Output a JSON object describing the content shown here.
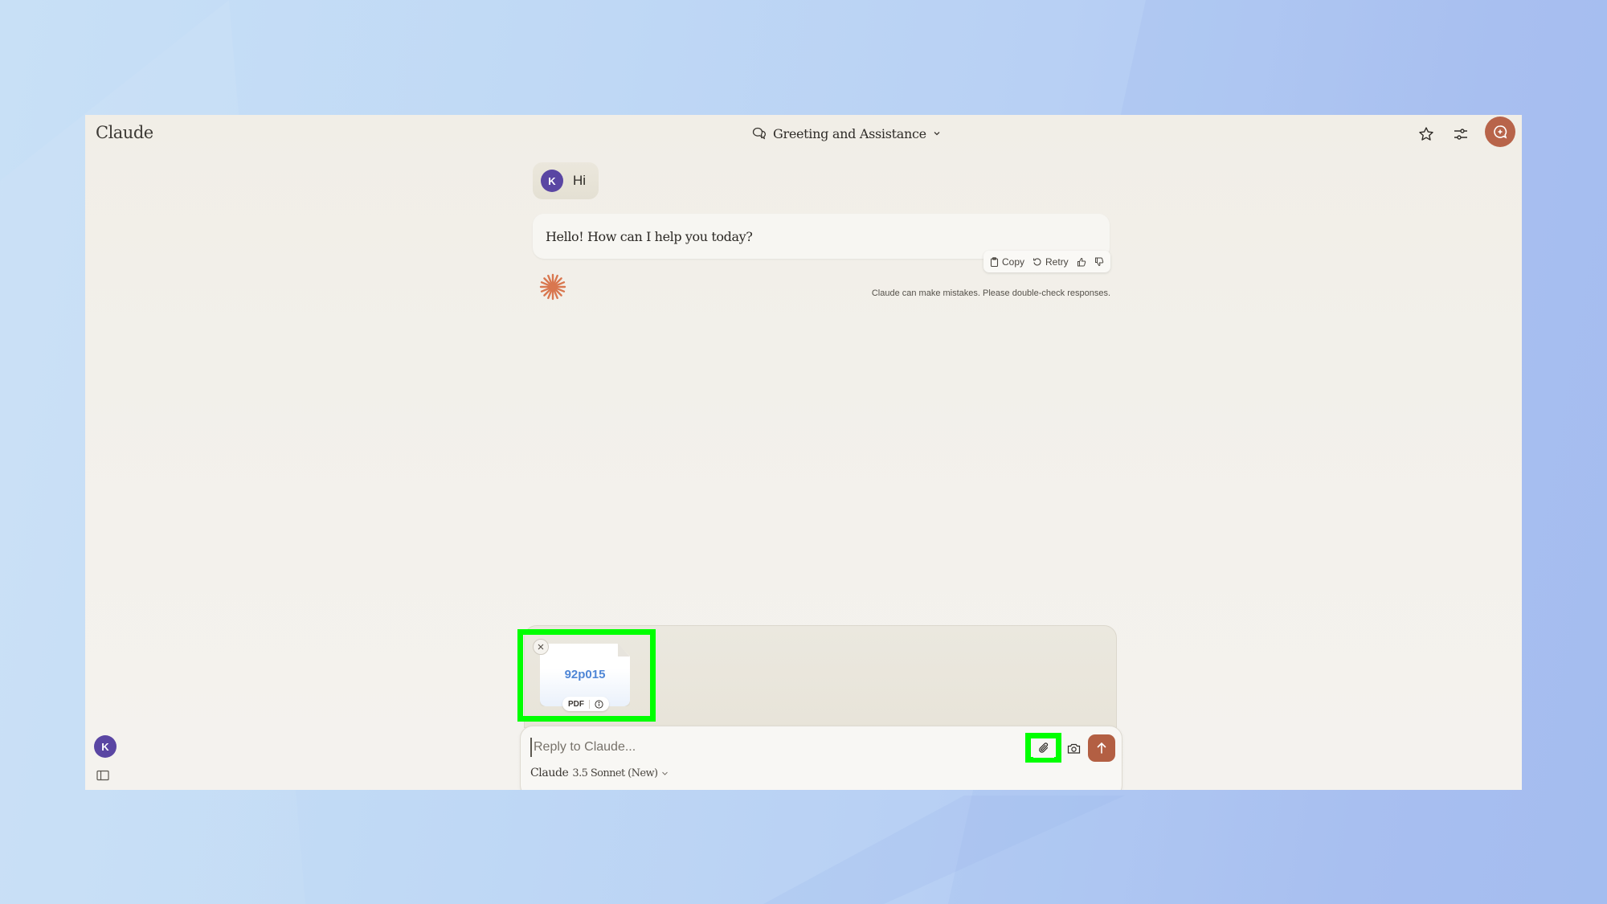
{
  "app": {
    "title": "Claude"
  },
  "header": {
    "conversation_title": "Greeting and Assistance",
    "icons": {
      "conversation": "chat-bubbles-icon",
      "dropdown": "chevron-down-icon",
      "star": "star-icon",
      "settings": "sliders-icon",
      "new_chat": "new-chat-icon"
    }
  },
  "colors": {
    "accent": "#b8644a",
    "send_button": "#b35f43",
    "avatar": "#5a46a3",
    "highlight": "#00ff00",
    "file_name": "#4f86d6"
  },
  "conversation": {
    "messages": [
      {
        "role": "user",
        "avatar_initial": "K",
        "text": "Hi"
      },
      {
        "role": "assistant",
        "text": "Hello! How can I help you today?"
      }
    ],
    "actions": {
      "copy_label": "Copy",
      "retry_label": "Retry",
      "thumbs_up": "thumbs-up-icon",
      "thumbs_down": "thumbs-down-icon"
    },
    "disclaimer": "Claude can make mistakes. Please double-check responses."
  },
  "attachments": [
    {
      "name": "92p015",
      "type": "PDF"
    }
  ],
  "composer": {
    "placeholder": "Reply to Claude...",
    "value": "",
    "model_brand": "Claude",
    "model_name": "3.5 Sonnet (New)"
  },
  "sidebar": {
    "user_initial": "K"
  }
}
